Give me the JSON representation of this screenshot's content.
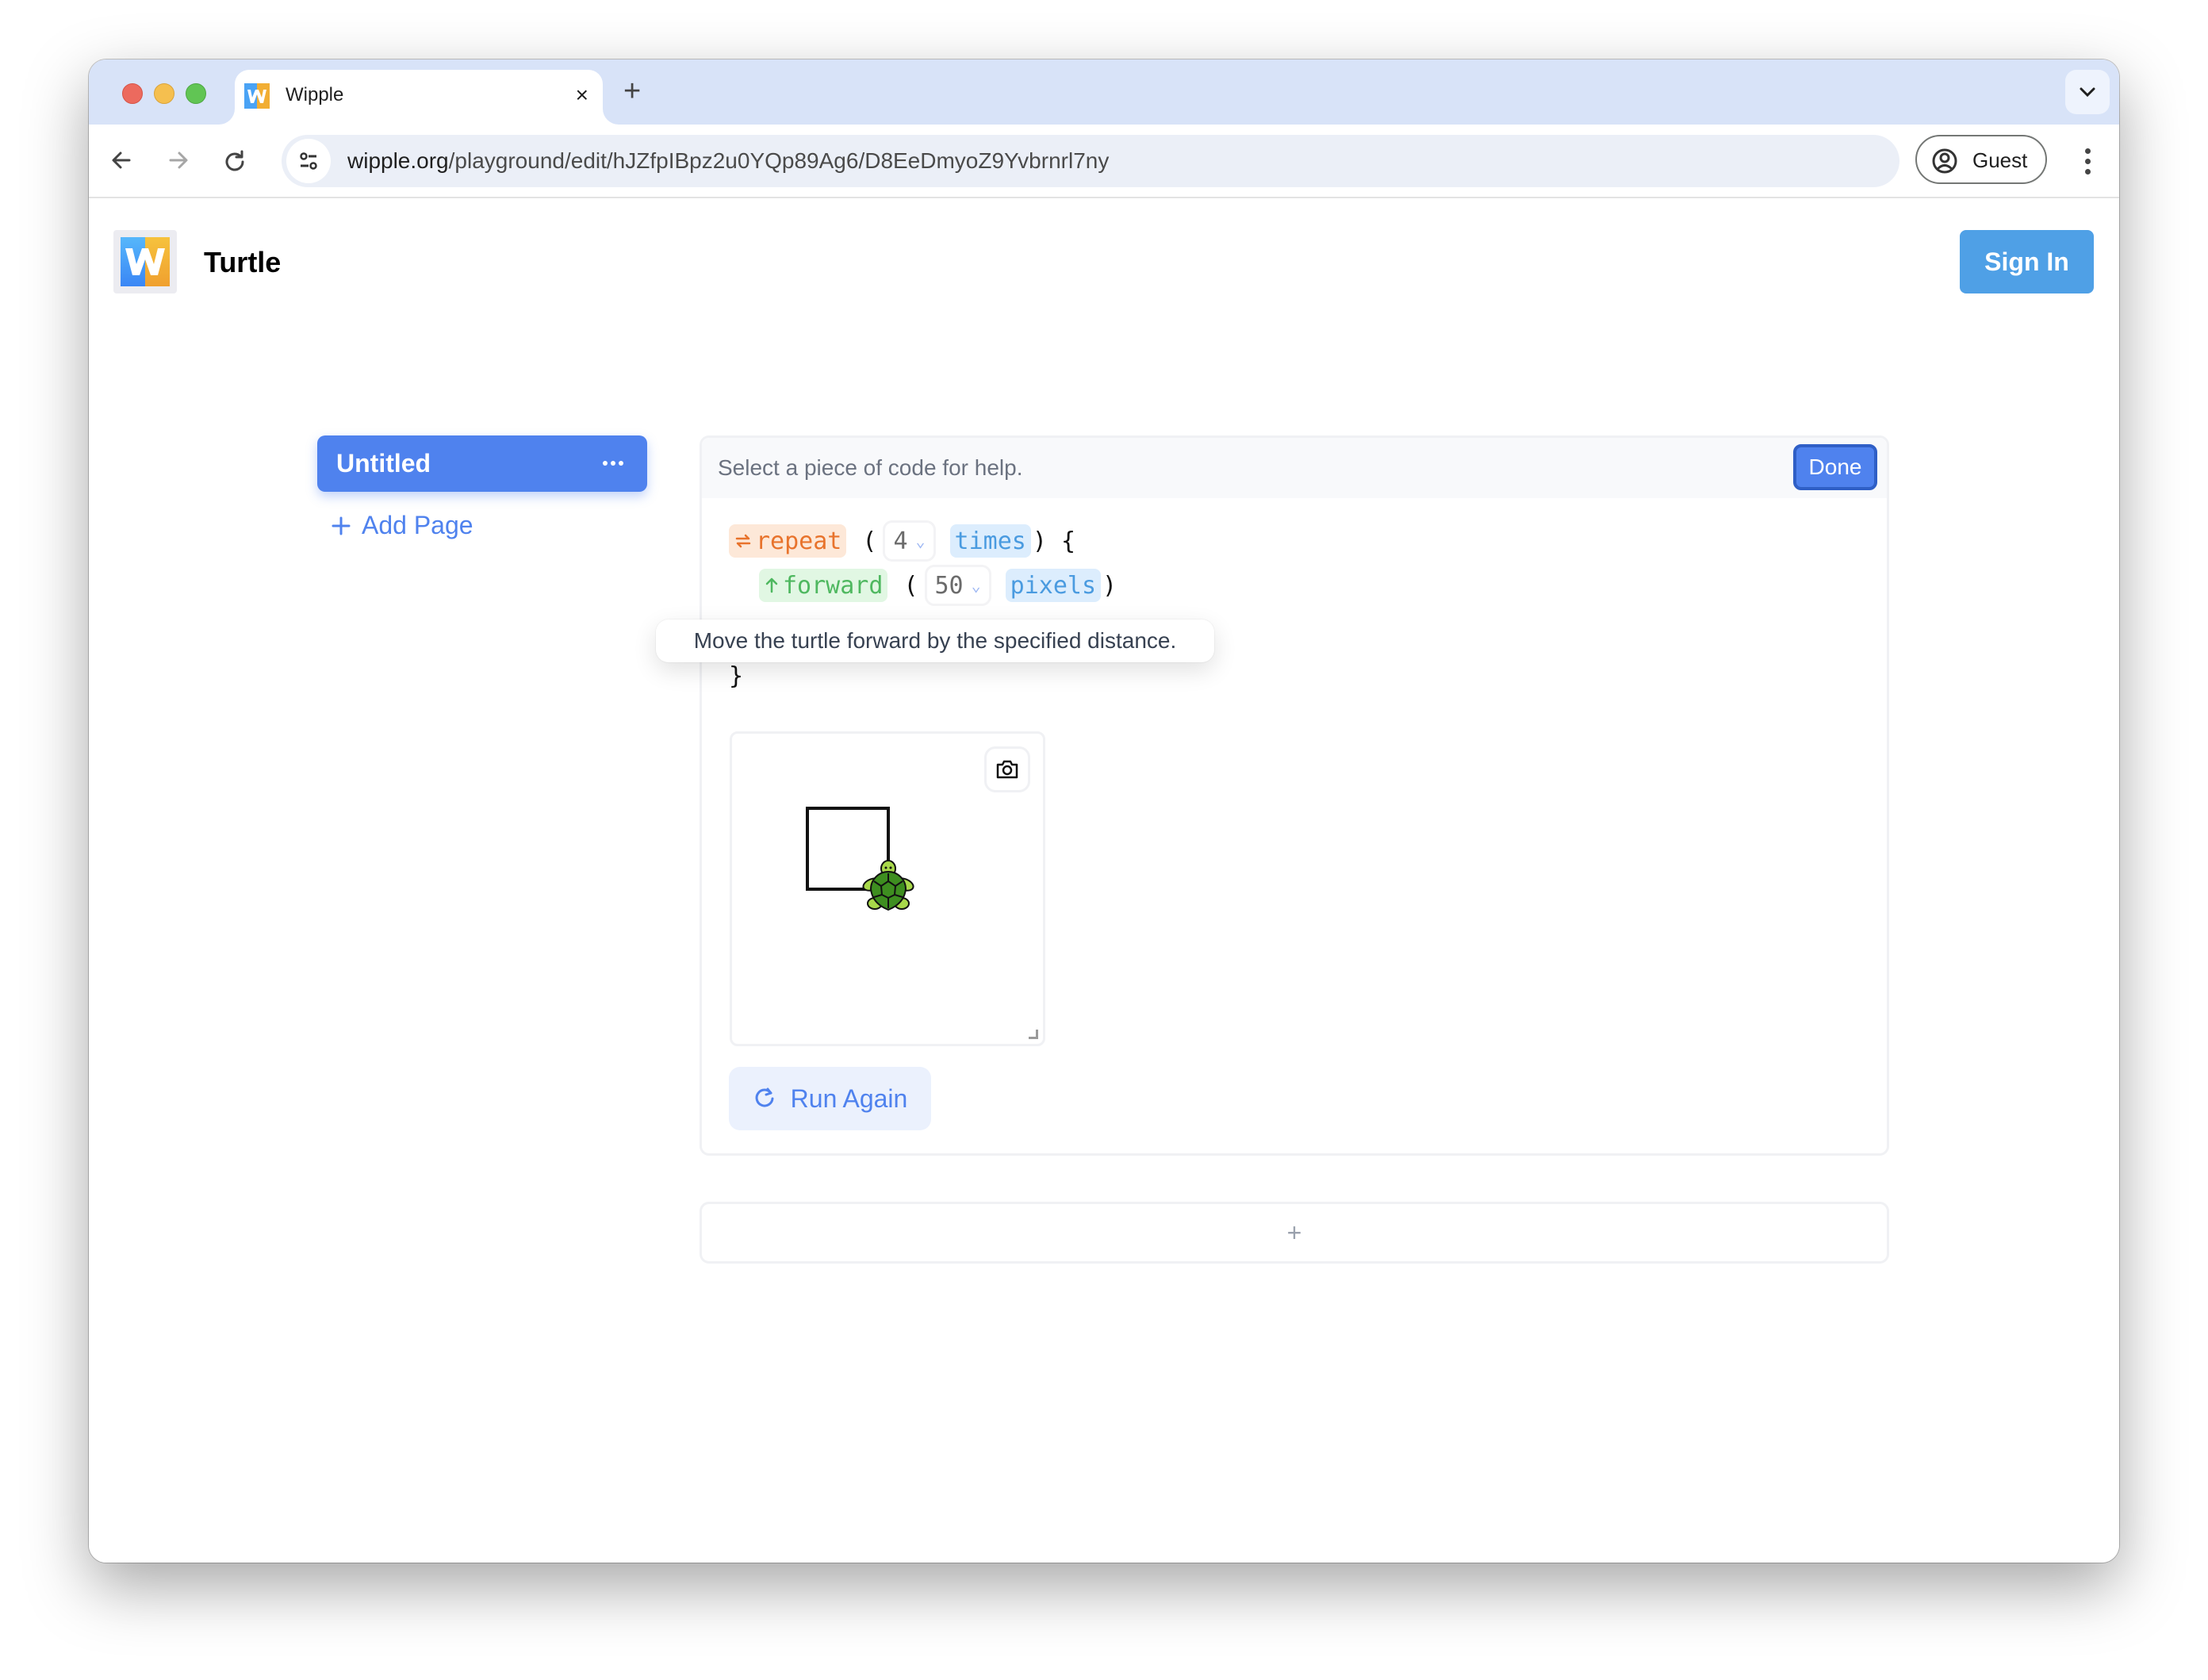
{
  "browser": {
    "tab": {
      "title": "Wipple",
      "close_label": "×"
    },
    "new_tab_label": "+",
    "url": {
      "host": "wipple.org",
      "path": "/playground/edit/hJZfpIBpz2u0YQp89Ag6/D8EeDmyoZ9Yvbrnrl7ny"
    },
    "profile": {
      "label": "Guest"
    },
    "icons": [
      "back-arrow-icon",
      "forward-arrow-icon",
      "reload-icon",
      "site-info-icon",
      "person-circle-icon",
      "kebab-menu-icon",
      "chevron-down-icon"
    ]
  },
  "header": {
    "logo_letter": "W",
    "title": "Turtle",
    "sign_in_label": "Sign In"
  },
  "sidebar": {
    "pages": [
      {
        "label": "Untitled",
        "selected": true
      }
    ],
    "add_page_label": "Add Page",
    "add_page_icon": "+"
  },
  "editor": {
    "help_text": "Select a piece of code for help.",
    "done_label": "Done",
    "code": {
      "line1": {
        "keyword": "repeat",
        "open_paren": "(",
        "value": "4",
        "unit": "times",
        "close": ") {"
      },
      "line2": {
        "keyword": "forward",
        "open_paren": "(",
        "value": "50",
        "unit": "pixels",
        "close": ")"
      },
      "line3": {
        "close": "}"
      }
    },
    "tooltip": "Move the turtle forward by the specified distance.",
    "run_again_label": "Run Again",
    "add_block_label": "+"
  },
  "colors": {
    "accent": "#4f82ee",
    "sign_in": "#4fa0e6",
    "repeat_token": "#e8732c",
    "forward_token": "#4fb860",
    "unit_token": "#4a9be0",
    "tabbar": "#d8e3f8"
  }
}
